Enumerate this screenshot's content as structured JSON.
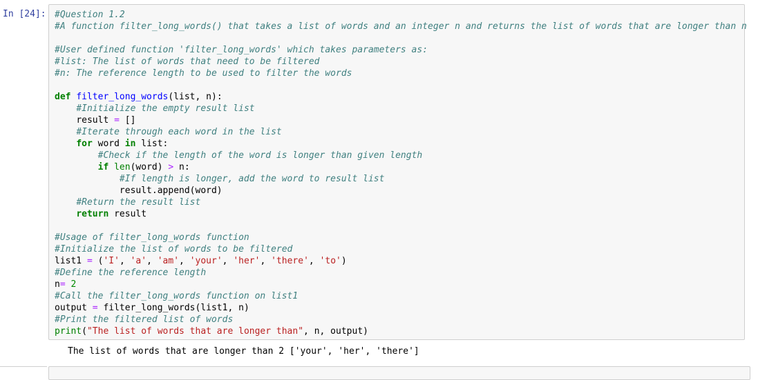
{
  "cell": {
    "prompt": "In [24]:",
    "code": {
      "l1": "#Question 1.2",
      "l2": "#A function filter_long_words() that takes a list of words and an integer n and returns the list of words that are longer than n",
      "l4": "#User defined function 'filter_long_words' which takes parameters as:",
      "l5": "#list: The list of words that need to be filtered",
      "l6": "#n: The reference length to be used to filter the words",
      "l8_kw": "def",
      "l8_name": "filter_long_words",
      "l8_rest": "(list, n):",
      "l9": "#Initialize the empty result list",
      "l10_a": "result ",
      "l10_op": "=",
      "l10_b": " []",
      "l11": "#Iterate through each word in the list",
      "l12_kw1": "for",
      "l12_a": " word ",
      "l12_kw2": "in",
      "l12_b": " list:",
      "l13": "#Check if the length of the word is longer than given length",
      "l14_kw": "if",
      "l14_sp": " ",
      "l14_bi": "len",
      "l14_a": "(word) ",
      "l14_op": ">",
      "l14_b": " n:",
      "l15": "#If length is longer, add the word to result list",
      "l16": "result.append(word)",
      "l17": "#Return the result list",
      "l18_kw": "return",
      "l18_a": " result",
      "l20": "#Usage of filter_long_words function",
      "l21": "#Initialize the list of words to be filtered",
      "l22_a": "list1 ",
      "l22_op": "=",
      "l22_b": " (",
      "l22_s1": "'I'",
      "l22_s2": "'a'",
      "l22_s3": "'am'",
      "l22_s4": "'your'",
      "l22_s5": "'her'",
      "l22_s6": "'there'",
      "l22_s7": "'to'",
      "l22_sep": ", ",
      "l22_end": ")",
      "l23": "#Define the reference length",
      "l24_a": "n",
      "l24_op": "=",
      "l24_sp": " ",
      "l24_num": "2",
      "l25": "#Call the filter_long_words function on list1",
      "l26_a": "output ",
      "l26_op": "=",
      "l26_b": " filter_long_words(list1, n)",
      "l27": "#Print the filtered list of words",
      "l28_bi": "print",
      "l28_a": "(",
      "l28_str": "\"The list of words that are longer than\"",
      "l28_b": ", n, output)"
    },
    "output": "The list of words that are longer than 2 ['your', 'her', 'there']"
  },
  "colors": {
    "prompt": "#303f9f",
    "comment": "#408080",
    "keyword": "#008000",
    "string": "#ba2121",
    "function_name": "#0000ff",
    "operator": "#aa22ff",
    "cell_background": "#f7f7f7",
    "cell_border": "#cfcfcf"
  }
}
